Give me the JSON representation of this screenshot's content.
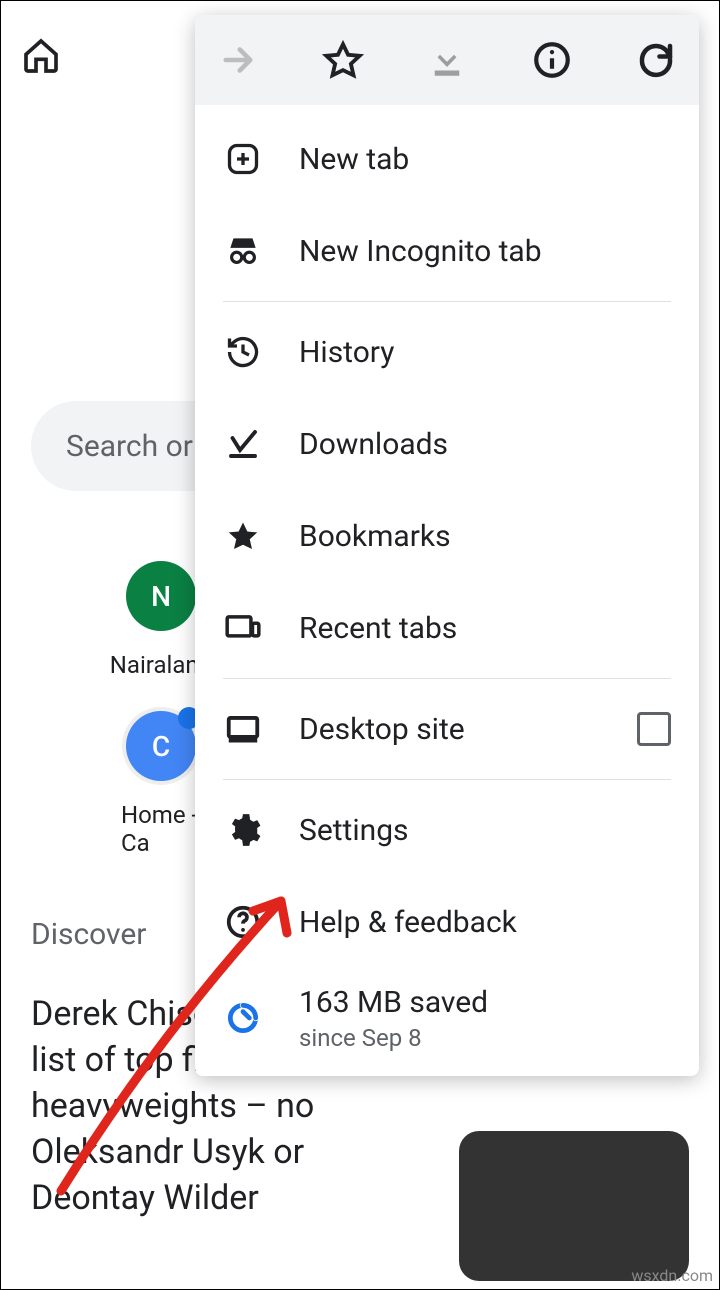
{
  "ntp": {
    "search_placeholder": "Search or",
    "tile1_letter": "N",
    "tile1_label": "Nairaland",
    "tile2_letter": "C",
    "tile2_label": "Home - Ca",
    "discover_label": "Discover",
    "article_text": "Derek Chisora's 'mental' list of top five heavyweights – no Oleksandr Usyk or Deontay Wilder"
  },
  "menu": {
    "new_tab": "New tab",
    "incognito": "New Incognito tab",
    "history": "History",
    "downloads": "Downloads",
    "bookmarks": "Bookmarks",
    "recent_tabs": "Recent tabs",
    "desktop_site": "Desktop site",
    "settings": "Settings",
    "help": "Help & feedback",
    "data_saved": "163 MB saved",
    "data_since": "since Sep 8"
  },
  "watermark": "wsxdn.com"
}
